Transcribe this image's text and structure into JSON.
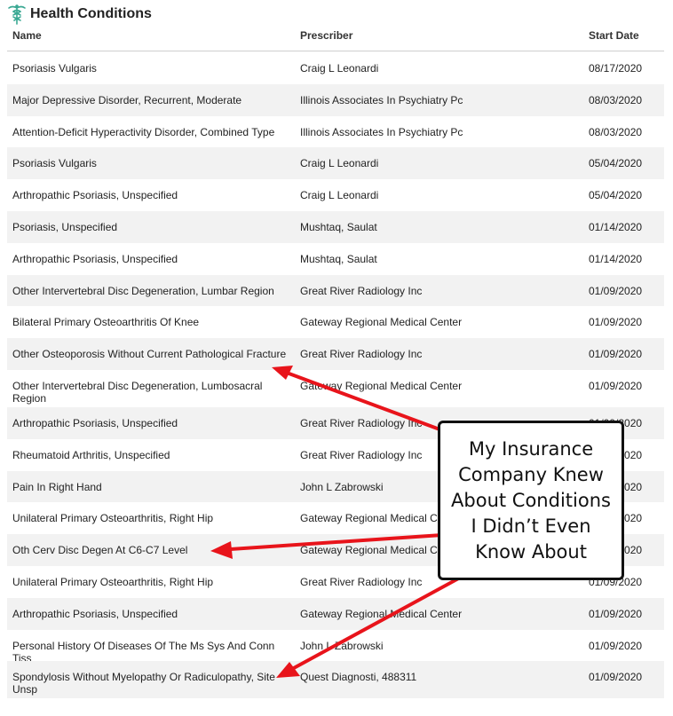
{
  "header": {
    "title": "Health Conditions",
    "icon": "caduceus-icon",
    "icon_color": "#3aa893"
  },
  "table": {
    "columns": [
      "Name",
      "Prescriber",
      "Start Date"
    ],
    "rows": [
      {
        "name": "Psoriasis Vulgaris",
        "prescriber": "Craig L Leonardi",
        "start_date": "08/17/2020"
      },
      {
        "name": "Major Depressive Disorder, Recurrent, Moderate",
        "prescriber": "Illinois Associates In Psychiatry Pc",
        "start_date": "08/03/2020"
      },
      {
        "name": "Attention-Deficit Hyperactivity Disorder, Combined Type",
        "prescriber": "Illinois Associates In Psychiatry Pc",
        "start_date": "08/03/2020"
      },
      {
        "name": "Psoriasis Vulgaris",
        "prescriber": "Craig L Leonardi",
        "start_date": "05/04/2020"
      },
      {
        "name": "Arthropathic Psoriasis, Unspecified",
        "prescriber": "Craig L Leonardi",
        "start_date": "05/04/2020"
      },
      {
        "name": "Psoriasis, Unspecified",
        "prescriber": "Mushtaq, Saulat",
        "start_date": "01/14/2020"
      },
      {
        "name": "Arthropathic Psoriasis, Unspecified",
        "prescriber": "Mushtaq, Saulat",
        "start_date": "01/14/2020"
      },
      {
        "name": "Other Intervertebral Disc Degeneration, Lumbar Region",
        "prescriber": "Great River Radiology Inc",
        "start_date": "01/09/2020"
      },
      {
        "name": "Bilateral Primary Osteoarthritis Of Knee",
        "prescriber": "Gateway Regional Medical Center",
        "start_date": "01/09/2020"
      },
      {
        "name": "Other Osteoporosis Without Current Pathological Fracture",
        "prescriber": "Great River Radiology Inc",
        "start_date": "01/09/2020"
      },
      {
        "name": "Other Intervertebral Disc Degeneration, Lumbosacral Region",
        "prescriber": "Gateway Regional Medical Center",
        "start_date": "01/09/2020"
      },
      {
        "name": "Arthropathic Psoriasis, Unspecified",
        "prescriber": "Great River Radiology Inc",
        "start_date": "01/09/2020"
      },
      {
        "name": "Rheumatoid Arthritis, Unspecified",
        "prescriber": "Great River Radiology Inc",
        "start_date": "01/09/2020"
      },
      {
        "name": "Pain In Right Hand",
        "prescriber": "John L Zabrowski",
        "start_date": "01/09/2020"
      },
      {
        "name": "Unilateral Primary Osteoarthritis, Right Hip",
        "prescriber": "Gateway Regional Medical Center",
        "start_date": "01/09/2020"
      },
      {
        "name": "Oth Cerv Disc Degen At C6-C7 Level",
        "prescriber": "Gateway Regional Medical Center",
        "start_date": "01/09/2020"
      },
      {
        "name": "Unilateral Primary Osteoarthritis, Right Hip",
        "prescriber": "Great River Radiology Inc",
        "start_date": "01/09/2020"
      },
      {
        "name": "Arthropathic Psoriasis, Unspecified",
        "prescriber": "Gateway Regional Medical Center",
        "start_date": "01/09/2020"
      },
      {
        "name": "Personal History Of Diseases Of The Ms Sys And Conn Tiss",
        "prescriber": "John L Zabrowski",
        "start_date": "01/09/2020"
      },
      {
        "name": "Spondylosis Without Myelopathy Or Radiculopathy, Site Unsp",
        "prescriber": "Quest Diagnosti, 488311",
        "start_date": "01/09/2020"
      }
    ]
  },
  "annotation": {
    "text": "My Insurance Company Knew About Conditions I Didn’t Even Know About",
    "arrow_color": "#e8141b"
  }
}
